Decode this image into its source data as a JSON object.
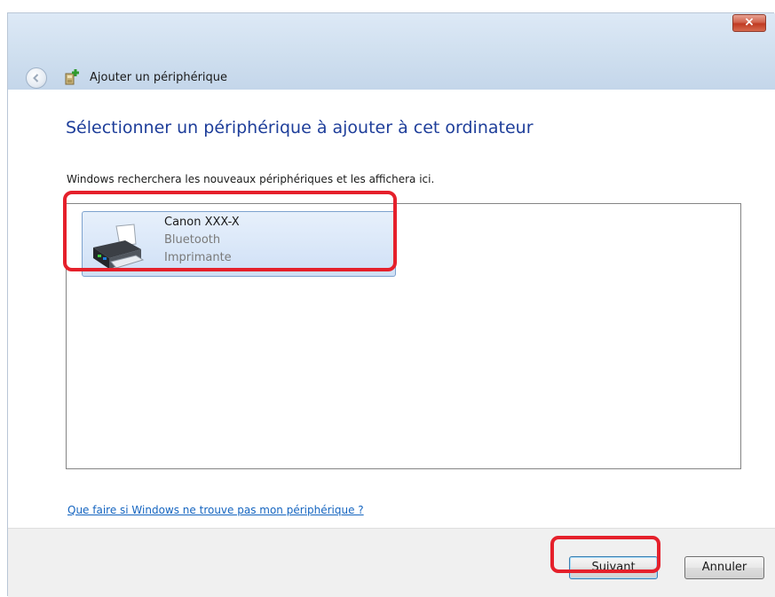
{
  "window": {
    "title": "Ajouter un périphérique",
    "close_label": "×"
  },
  "main": {
    "heading": "Sélectionner un périphérique à ajouter à cet ordinateur",
    "subtext": "Windows recherchera les nouveaux périphériques et les affichera ici.",
    "devices": [
      {
        "name": "Canon XXX-X",
        "connection": "Bluetooth",
        "category": "Imprimante",
        "icon": "printer-icon",
        "selected": true
      }
    ],
    "help_link": "Que faire si Windows ne trouve pas mon périphérique ?"
  },
  "footer": {
    "next_label": "Suivant",
    "cancel_label": "Annuler"
  },
  "colors": {
    "heading": "#1e3e9a",
    "link": "#1565c0",
    "highlight": "#e5202b",
    "selection": "#cfe0f6"
  }
}
